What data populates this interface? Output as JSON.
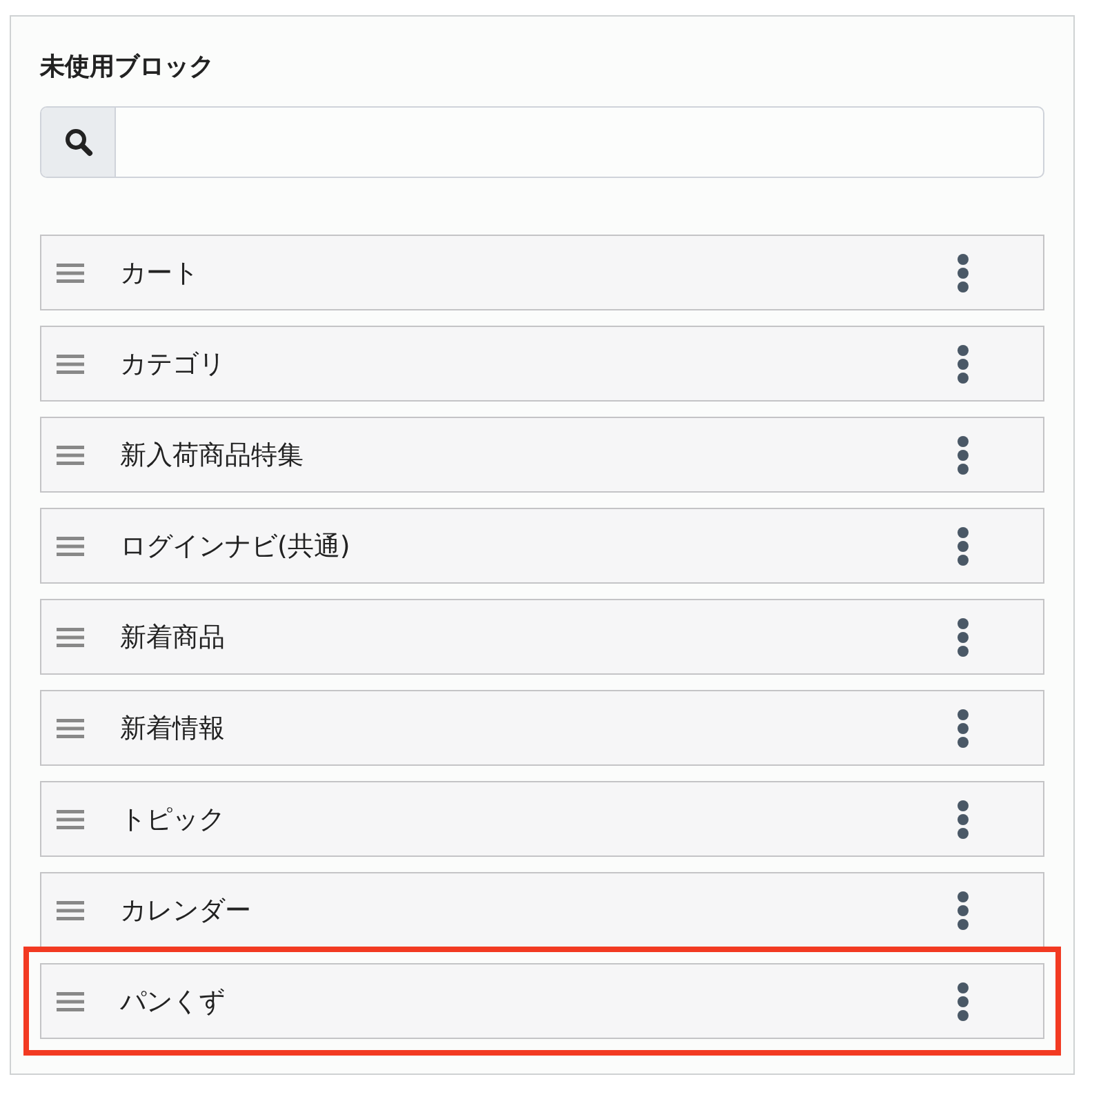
{
  "panel": {
    "title": "未使用ブロック",
    "blocks": [
      {
        "label": "カート",
        "highlighted": false
      },
      {
        "label": "カテゴリ",
        "highlighted": false
      },
      {
        "label": "新入荷商品特集",
        "highlighted": false
      },
      {
        "label": "ログインナビ(共通)",
        "highlighted": false
      },
      {
        "label": "新着商品",
        "highlighted": false
      },
      {
        "label": "新着情報",
        "highlighted": false
      },
      {
        "label": "トピック",
        "highlighted": false
      },
      {
        "label": "カレンダー",
        "highlighted": false
      },
      {
        "label": "パンくず",
        "highlighted": true
      }
    ]
  }
}
